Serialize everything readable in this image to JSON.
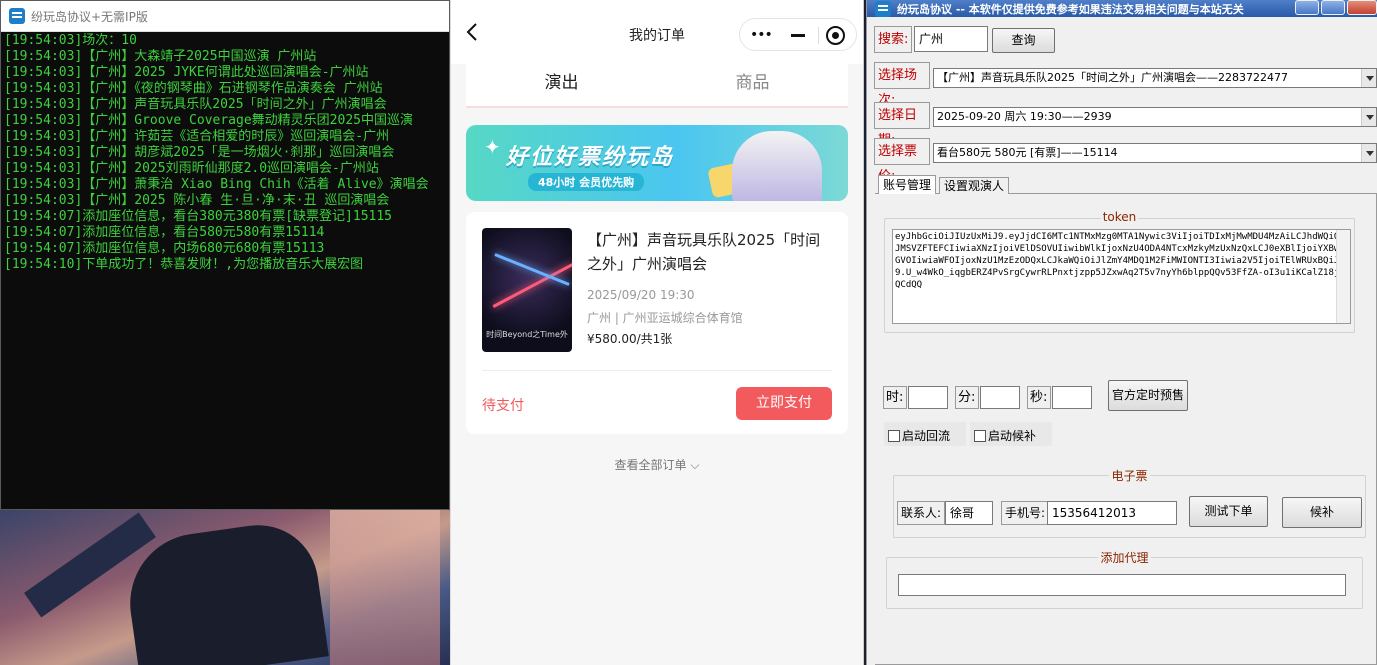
{
  "console": {
    "title": "纷玩岛协议+无需IP版",
    "lines": [
      "[19:54:03]场次：10",
      "[19:54:03]【广州】大森靖子2025中国巡演 广州站",
      "[19:54:03]【广州】2025 JYKE何谓此处巡回演唱会-广州站",
      "[19:54:03]【广州】《夜的钢琴曲》石进钢琴作品演奏会 广州站",
      "[19:54:03]【广州】声音玩具乐队2025「时间之外」广州演唱会",
      "[19:54:03]【广州】Groove Coverage舞动精灵乐团2025中国巡演",
      "[19:54:03]【广州】许茹芸《适合相爱的时辰》巡回演唱会-广州",
      "[19:54:03]【广州】胡彦斌2025「是一场烟火·刹那」巡回演唱会",
      "[19:54:03]【广州】2025刘雨昕仙那度2.0巡回演唱会-广州站",
      "[19:54:03]【广州】萧秉治 Xiao Bing Chih《活着 Alive》演唱会",
      "[19:54:03]【广州】2025 陈小春 生·旦·净·末·丑 巡回演唱会",
      "[19:54:07]添加座位信息，看台380元380有票[缺票登记]15115",
      "[19:54:07]添加座位信息，看台580元580有票15114",
      "[19:54:07]添加座位信息，内场680元680有票15113",
      "[19:54:10]下单成功了！恭喜发财！,为您播放音乐大展宏图"
    ]
  },
  "phone": {
    "nav_title": "我的订单",
    "capsule_dots": "•••",
    "tabs": [
      {
        "label": "演出"
      },
      {
        "label": "商品"
      }
    ],
    "banner": {
      "title": "好位好票纷玩岛",
      "subtitle": "48小时 会员优先购"
    },
    "order": {
      "poster_text": "时间Beyond之Time外",
      "name": "【广州】声音玩具乐队2025「时间之外」广州演唱会",
      "date": "2025/09/20 19:30",
      "venue": "广州 | 广州亚运城综合体育馆",
      "price": "¥580.00/共1张",
      "status": "待支付",
      "pay_button": "立即支付"
    },
    "view_all": "查看全部订单 ⌵"
  },
  "tool": {
    "title": "纷玩岛协议 -- 本软件仅提供免费参考如果违法交易相关问题与本站无关",
    "search_label": "搜索:",
    "search_value": "广州",
    "query_button": "查询",
    "session_label": "选择场次:",
    "session_value": "【广州】声音玩具乐队2025「时间之外」广州演唱会——2283722477",
    "date_label": "选择日期:",
    "date_value": "2025-09-20 周六 19:30——2939",
    "price_label": "选择票价:",
    "price_value": "看台580元 580元 [有票]——15114",
    "tabs": [
      {
        "label": "账号管理"
      },
      {
        "label": "设置观演人"
      }
    ],
    "token_label": "token",
    "token_value": "eyJhbGciOiJIUzUxMiJ9.eyJjdCI6MTc1NTMxMzg0MTA1Nywic3ViIjoiTDIxMjMwMDU4MzAiLCJhdWQiOiJMSVZFTEFCIiwiaXNzIjoiVElDSOVUIiwibWlkIjoxNzU4ODA4NTcxMzkyMzUxNzQxLCJ0eXBlIjoiYXBwbGVOIiwiaWFOIjoxNzU1MzEzODQxLCJkaWQiOiJlZmY4MDQ1M2FiMWIONTI3Iiwia2V5IjoiTElWRUxBQiJ9.U_w4WkO_iqgbERZ4PvSrgCywrRLPnxtjzpp5JZxwAq2T5v7nyYh6blppQQv53FfZA-oI3u1iKCalZ18jnQCdQQ",
    "hour_label": "时:",
    "minute_label": "分:",
    "second_label": "秒:",
    "timer_button": "官方定时预售",
    "auto_retry": "启动回流",
    "auto_wait": "启动候补",
    "eticket_label": "电子票",
    "contact_label": "联系人:",
    "contact_value": "徐哥",
    "phone_label": "手机号:",
    "phone_value": "15356412013",
    "test_order_button": "测试下单",
    "waitlist_button": "候补",
    "proxy_label": "添加代理",
    "proxy_value": ""
  }
}
